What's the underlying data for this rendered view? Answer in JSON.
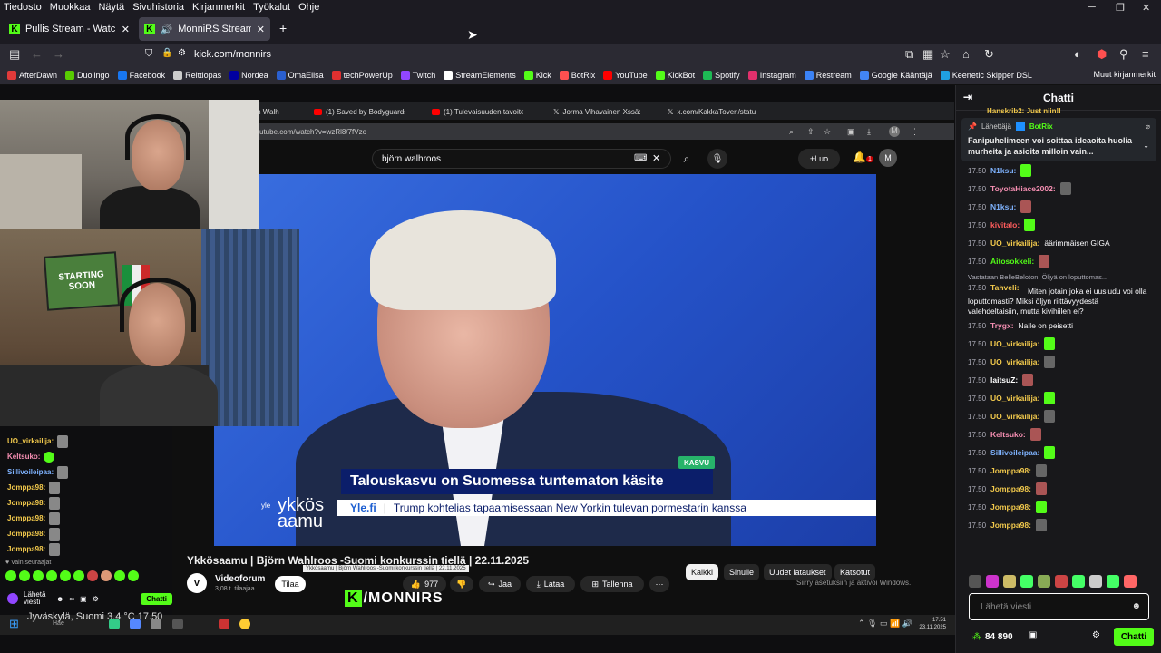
{
  "menubar": [
    "Tiedosto",
    "Muokkaa",
    "Näytä",
    "Sivuhistoria",
    "Kirjanmerkit",
    "Työkalut",
    "Ohje"
  ],
  "tabs": [
    {
      "title": "Pullis Stream - Watch Live o",
      "active": false
    },
    {
      "title": "MonniRS Stream - Watch Li",
      "active": true
    }
  ],
  "url": "kick.com/monnirs",
  "bookmarks": [
    {
      "label": "AfterDawn",
      "color": "#e03a3a"
    },
    {
      "label": "Duolingo",
      "color": "#58cc02"
    },
    {
      "label": "Facebook",
      "color": "#1877f2"
    },
    {
      "label": "Reittiopas",
      "color": "#cccccc"
    },
    {
      "label": "Nordea",
      "color": "#0000a0"
    },
    {
      "label": "OmaElisa",
      "color": "#2a5fd0"
    },
    {
      "label": "techPowerUp",
      "color": "#e03030"
    },
    {
      "label": "Twitch",
      "color": "#9146ff"
    },
    {
      "label": "StreamElements",
      "color": "#ffffff"
    },
    {
      "label": "Kick",
      "color": "#53fc18"
    },
    {
      "label": "BotRix",
      "color": "#ff5050"
    },
    {
      "label": "YouTube",
      "color": "#ff0000"
    },
    {
      "label": "KickBot",
      "color": "#53fc18"
    },
    {
      "label": "Spotify",
      "color": "#1db954"
    },
    {
      "label": "Instagram",
      "color": "#e1306c"
    },
    {
      "label": "Restream",
      "color": "#3b82f6"
    },
    {
      "label": "Google Kääntäjä",
      "color": "#4285f4"
    },
    {
      "label": "Keenetic Skipper DSL",
      "color": "#20a0e0"
    }
  ],
  "bookmarks_other": "Muut kirjanmerkit",
  "inner_browser": {
    "tabs": [
      "örn Walh",
      "(1) Saved by Bodyguards in Ma",
      "(1) Tulevaisuuden tavoite | 300",
      "Jorma Vihavainen Xssä: \"Björn",
      "x.com/KakkaToveri/status/1992"
    ],
    "url": "utube.com/watch?v=wzRl8/7fVzo",
    "search": "björn walhroos",
    "create": "Luo",
    "bell_count": "1",
    "avatar": "M"
  },
  "video": {
    "badge": "KASVU",
    "headline": "Talouskasvu on Suomessa tuntematon käsite",
    "ticker_source": "Yle.fi",
    "ticker_text": "Trump kohtelias tapaamisessaan New Yorkin tulevan pormestarin kanssa",
    "show_logo": "ykkös\naamu",
    "yle": "yle"
  },
  "video_title": "Ykkösaamu | Björn Wahlroos -Suomi konkurssin tiellä | 22.11.2025",
  "tooltip": "Ykkösaamu | Björn Wahlroos -Suomi konkurssin tiellä | 22.11.2025",
  "channel": {
    "name": "Videoforum",
    "subs": "3,08 t. tilaajaa",
    "subscribe": "Tilaa",
    "likes": "977",
    "share": "Jaa",
    "download": "Lataa",
    "save": "Tallenna"
  },
  "chips": [
    "Kaikki",
    "Sinulle",
    "Uudet lataukset",
    "Katsotut"
  ],
  "activate_windows": "Siirry asetuksiin ja aktivoi Windows.",
  "overlay": {
    "chat": [
      {
        "user": "UO_virkailija:",
        "color": "#f2c94c"
      },
      {
        "user": "Keltsuko:",
        "color": "#f78fb3"
      },
      {
        "user": "Sillivoileipaa:",
        "color": "#7fb3ff"
      },
      {
        "user": "Jomppa98:",
        "color": "#f2c94c"
      },
      {
        "user": "Jomppa98:",
        "color": "#f2c94c"
      },
      {
        "user": "Jomppa98:",
        "color": "#f2c94c"
      },
      {
        "user": "Jomppa98:",
        "color": "#f2c94c"
      },
      {
        "user": "Jomppa98:",
        "color": "#f2c94c"
      }
    ],
    "follow": "Vain seuraajat",
    "send": "Lähetä viesti",
    "chat_btn": "Chatti",
    "poster": "STARTING SOON",
    "kick_brand": "/MONNIRS",
    "kick_k": "K"
  },
  "taskbar": {
    "weather": "Jyväskylä, Suomi  3,4 °C  17.50",
    "search": "Hae",
    "time": "17.51",
    "date": "23.11.2025"
  },
  "chat": {
    "title": "Chatti",
    "pinned_by": "Lähettäjä",
    "pinned_user": "BotRix",
    "pinned_msg": "Fanipuhelimeen voi soittaa ideaoita huolia murheita ja asioita milloin vain...",
    "top_user": "Hanskrib2: Just niin!!",
    "messages": [
      {
        "time": "17.50",
        "user": "N1ksu:",
        "color": "#7fb3ff",
        "text": ""
      },
      {
        "time": "17.50",
        "user": "ToyotaHiace2002:",
        "color": "#f78fb3",
        "text": ""
      },
      {
        "time": "17.50",
        "user": "N1ksu:",
        "color": "#7fb3ff",
        "text": ""
      },
      {
        "time": "17.50",
        "user": "kivitalo:",
        "color": "#ff5c5c",
        "text": ""
      },
      {
        "time": "17.50",
        "user": "UO_virkailija:",
        "color": "#f2c94c",
        "text": "äärimmäisen GIGA"
      },
      {
        "time": "17.50",
        "user": "Aitosokkeli:",
        "color": "#53fc18",
        "text": ""
      }
    ],
    "reply_note": "Vastataan BelleBeloton: Öljyä on loputtomas...",
    "reply_msg": {
      "time": "17.50",
      "user": "Tahveli:",
      "color": "#f2c94c",
      "text": "Miten jotain joka ei uusiudu voi olla loputtomasti? Miksi öljyn riittävyydestä valehdeltaisiin, mutta kivihiilen ei?"
    },
    "messages2": [
      {
        "time": "17.50",
        "user": "Trygx:",
        "color": "#f78fb3",
        "text": "Nalle on peisetti"
      },
      {
        "time": "17.50",
        "user": "UO_virkailija:",
        "color": "#f2c94c",
        "text": ""
      },
      {
        "time": "17.50",
        "user": "UO_virkailija:",
        "color": "#f2c94c",
        "text": ""
      },
      {
        "time": "17.50",
        "user": "laitsuZ:",
        "color": "#ffffff",
        "text": ""
      },
      {
        "time": "17.50",
        "user": "UO_virkailija:",
        "color": "#f2c94c",
        "text": ""
      },
      {
        "time": "17.50",
        "user": "UO_virkailija:",
        "color": "#f2c94c",
        "text": ""
      },
      {
        "time": "17.50",
        "user": "Keltsuko:",
        "color": "#f78fb3",
        "text": ""
      },
      {
        "time": "17.50",
        "user": "Sillivoileipaa:",
        "color": "#7fb3ff",
        "text": ""
      },
      {
        "time": "17.50",
        "user": "Jomppa98:",
        "color": "#f2c94c",
        "text": ""
      },
      {
        "time": "17.50",
        "user": "Jomppa98:",
        "color": "#f2c94c",
        "text": ""
      },
      {
        "time": "17.50",
        "user": "Jomppa98:",
        "color": "#f2c94c",
        "text": ""
      },
      {
        "time": "17.50",
        "user": "Jomppa98:",
        "color": "#f2c94c",
        "text": ""
      }
    ],
    "input_placeholder": "Lähetä viesti",
    "viewers": "84 890",
    "send": "Chatti"
  }
}
